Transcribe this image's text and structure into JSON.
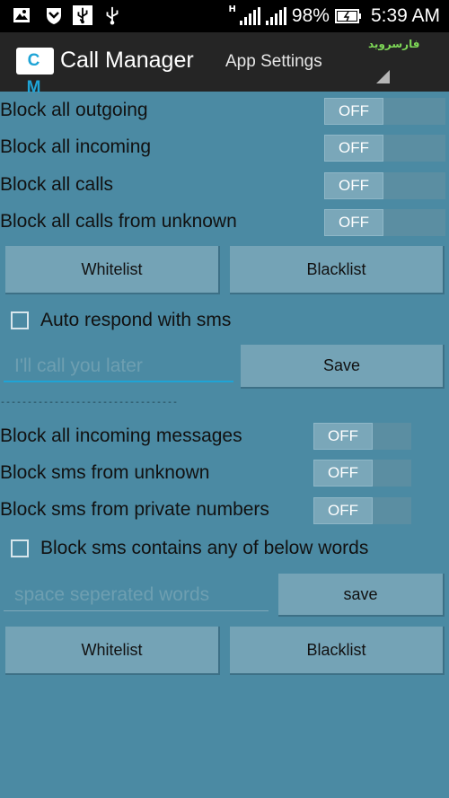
{
  "status_bar": {
    "network_label": "H",
    "battery": "98%",
    "time": "5:39 AM",
    "icons": [
      "image-icon",
      "shield-icon",
      "usb-icon",
      "usb-icon",
      "signal-icon",
      "signal-icon",
      "battery-icon"
    ]
  },
  "action_bar": {
    "logo": "C M",
    "title": "Call Manager",
    "settings_tab": "App Settings",
    "watermark": "فارسروید"
  },
  "calls": {
    "toggles": [
      {
        "label": "Block all outgoing",
        "state": "OFF"
      },
      {
        "label": "Block all incoming",
        "state": "OFF"
      },
      {
        "label": "Block all calls",
        "state": "OFF"
      },
      {
        "label": "Block all calls from unknown",
        "state": "OFF"
      }
    ],
    "whitelist_label": "Whitelist",
    "blacklist_label": "Blacklist",
    "auto_respond_label": "Auto respond with sms",
    "auto_respond_placeholder": "I'll call you later",
    "save_label": "Save"
  },
  "divider": "---------------------------------",
  "sms": {
    "toggles": [
      {
        "label": "Block all incoming messages",
        "state": "OFF"
      },
      {
        "label": "Block sms from unknown",
        "state": "OFF"
      },
      {
        "label": "Block sms from private numbers",
        "state": "OFF"
      }
    ],
    "words_check_label": "Block sms contains any of below words",
    "words_placeholder": "space seperated words",
    "save_label": "save",
    "whitelist_label": "Whitelist",
    "blacklist_label": "Blacklist"
  },
  "colors": {
    "background": "#4b8aa3",
    "action_bar": "#252525",
    "button": "#74a3b6",
    "toggle_knob": "#7aa7b9",
    "accent_line": "#1fa4d6"
  }
}
